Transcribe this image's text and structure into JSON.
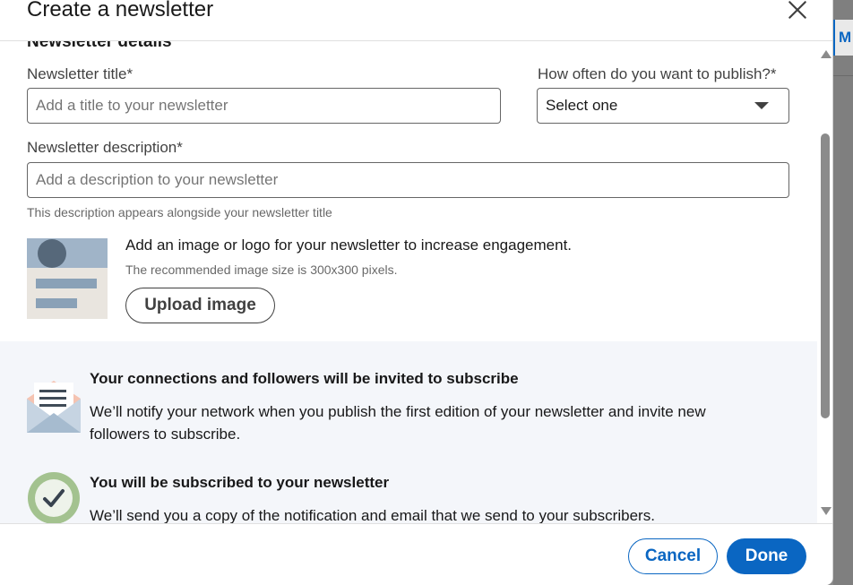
{
  "dialog": {
    "title": "Create a newsletter",
    "close_icon": "close-icon"
  },
  "backdrop": {
    "chip_text": "M"
  },
  "details": {
    "heading": "Newsletter details",
    "title_label": "Newsletter title*",
    "title_placeholder": "Add a title to your newsletter",
    "title_value": "",
    "frequency_label": "How often do you want to publish?*",
    "frequency_selected": "Select one",
    "description_label": "Newsletter description*",
    "description_placeholder": "Add a description to your newsletter",
    "description_value": "",
    "description_helper": "This description appears alongside your newsletter title"
  },
  "image_section": {
    "prompt": "Add an image or logo for your newsletter to increase engagement.",
    "recommendation": "The recommended image size is 300x300 pixels.",
    "upload_label": "Upload image"
  },
  "info": [
    {
      "icon": "envelope-icon",
      "title": "Your connections and followers will be invited to subscribe",
      "body": "We’ll notify your network when you publish the first edition of your newsletter and invite new followers to subscribe."
    },
    {
      "icon": "checkmark-icon",
      "title": "You will be subscribed to your newsletter",
      "body": "We’ll send you a copy of the notification and email that we send to your subscribers."
    }
  ],
  "footer": {
    "cancel_label": "Cancel",
    "done_label": "Done"
  },
  "colors": {
    "primary": "#0a66c2",
    "info_panel_bg": "#f4f6fa",
    "check_ring": "#a3c28f"
  }
}
